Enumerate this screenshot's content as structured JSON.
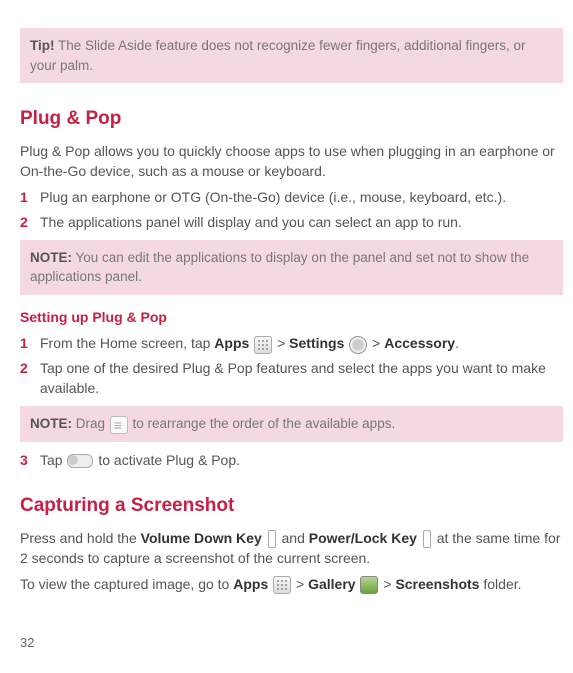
{
  "tip": {
    "label": "Tip!",
    "text": "The Slide Aside feature does not recognize fewer fingers, additional fingers, or your palm."
  },
  "plugPop": {
    "heading": "Plug & Pop",
    "intro": "Plug & Pop allows you to quickly choose apps to use when plugging in an earphone or On-the-Go device, such as a mouse or keyboard.",
    "steps": [
      {
        "num": "1",
        "text": "Plug an earphone or OTG (On-the-Go) device (i.e., mouse, keyboard, etc.)."
      },
      {
        "num": "2",
        "text": "The applications panel will display and you can select an app to run."
      }
    ],
    "note1": {
      "label": "NOTE:",
      "text": "You can edit the applications to display on the panel and set not to show the applications panel."
    },
    "subheading": "Setting up Plug & Pop",
    "setup": {
      "step1_num": "1",
      "step1_a": "From the Home screen, tap ",
      "step1_apps": "Apps",
      "step1_sep1": " > ",
      "step1_settings": "Settings",
      "step1_sep2": " > ",
      "step1_accessory": "Accessory",
      "step1_end": ".",
      "step2_num": "2",
      "step2_text": "Tap one of the desired Plug & Pop features and select the apps you want to make available."
    },
    "note2": {
      "label": "NOTE:",
      "pre": "Drag ",
      "post": " to rearrange the order of the available apps."
    },
    "step3_num": "3",
    "step3_a": "Tap ",
    "step3_b": " to activate Plug & Pop."
  },
  "capturing": {
    "heading": "Capturing a Screenshot",
    "p1_a": "Press and hold the ",
    "p1_vdk": "Volume Down Key",
    "p1_b": " and ",
    "p1_plk": "Power/Lock Key",
    "p1_c": " at the same time for 2 seconds to capture a screenshot of the current screen.",
    "p2_a": "To view the captured image, go to ",
    "p2_apps": "Apps",
    "p2_sep1": " > ",
    "p2_gallery": "Gallery",
    "p2_sep2": " > ",
    "p2_screenshots": "Screenshots",
    "p2_end": " folder."
  },
  "pageNumber": "32"
}
